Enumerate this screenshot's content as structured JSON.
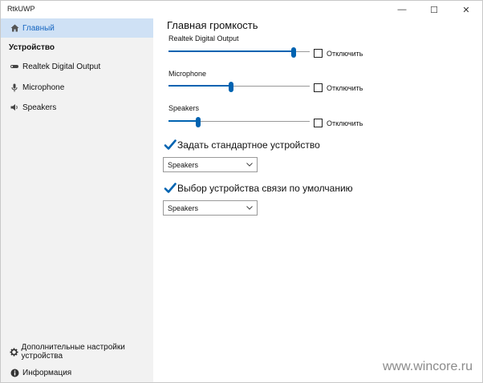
{
  "titlebar": {
    "app_title": "RtkUWP",
    "minimize_glyph": "—",
    "maximize_glyph": "☐",
    "close_glyph": "✕"
  },
  "sidebar": {
    "home_label": "Главный",
    "devices_header": "Устройство",
    "items": [
      {
        "label": "Realtek Digital Output",
        "icon": "digital-output-icon"
      },
      {
        "label": "Microphone",
        "icon": "microphone-icon"
      },
      {
        "label": "Speakers",
        "icon": "speaker-icon"
      }
    ],
    "settings_label": "Дополнительные настройки устройства",
    "info_label": "Информация"
  },
  "main": {
    "title": "Главная громкость",
    "mute_label": "Отключить",
    "devices": [
      {
        "name": "Realtek Digital Output",
        "volume": 0.9,
        "muted": false
      },
      {
        "name": "Microphone",
        "volume": 0.44,
        "muted": false
      },
      {
        "name": "Speakers",
        "volume": 0.2,
        "muted": false
      }
    ],
    "default_device": {
      "label": "Задать стандартное устройство",
      "checked": true,
      "selected": "Speakers"
    },
    "default_comm_device": {
      "label": "Выбор устройства связи по умолчанию",
      "checked": true,
      "selected": "Speakers"
    }
  },
  "colors": {
    "accent": "#0063b1",
    "nav_selected_bg": "#cfe1f5",
    "nav_selected_text": "#1565c0",
    "sidebar_bg": "#f2f2f2"
  },
  "watermark": "www.wincore.ru"
}
